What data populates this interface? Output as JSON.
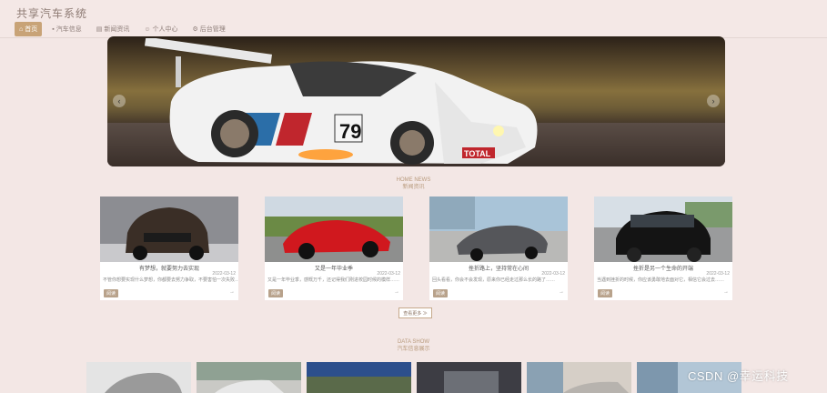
{
  "header": {
    "title": "共享汽车系统",
    "nav": [
      {
        "label": "首页",
        "icon": "home-icon",
        "active": true
      },
      {
        "label": "汽车信息",
        "icon": "car-icon",
        "active": false
      },
      {
        "label": "新闻资讯",
        "icon": "news-icon",
        "active": false
      },
      {
        "label": "个人中心",
        "icon": "user-icon",
        "active": false
      },
      {
        "label": "后台管理",
        "icon": "admin-icon",
        "active": false
      }
    ]
  },
  "banner": {
    "car_number": "79",
    "sponsor_text": "TOTAL",
    "prev_glyph": "‹",
    "next_glyph": "›"
  },
  "news": {
    "heading_en": "HOME NEWS",
    "heading_zh": "新闻资讯",
    "items": [
      {
        "title": "有梦想，就要努力去实现",
        "date": "2022-03-12",
        "desc": "不管你想要实现什么梦想，你都要去努力争取，不要害怕一次失败……",
        "button": "阅读"
      },
      {
        "title": "又是一年毕业季",
        "date": "2022-03-12",
        "desc": "又是一年毕业季，感慨万千，还记得我们刚进校园时候的模样……",
        "button": "阅读"
      },
      {
        "title": "挫折路上，坚持常在心间",
        "date": "2022-03-12",
        "desc": "回头看看，你会不会发现，原来你已经走过那么长的路了……",
        "button": "阅读"
      },
      {
        "title": "挫折是另一个生命的开端",
        "date": "2022-03-12",
        "desc": "当遇到挫折的时候，你应该勇敢地去面对它，相信它会过去……",
        "button": "阅读"
      }
    ],
    "more_label": "查看更多 ≫"
  },
  "data_show": {
    "heading_en": "DATA SHOW",
    "heading_zh": "汽车信息展示"
  },
  "watermark": "CSDN @幸运科技",
  "colors": {
    "accent": "#c8a377",
    "background": "#f3e7e5"
  }
}
